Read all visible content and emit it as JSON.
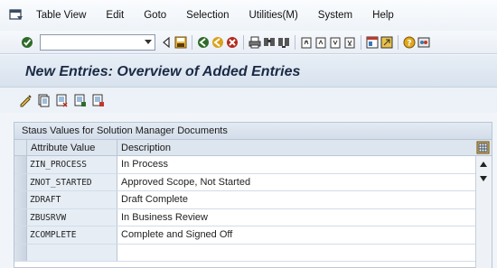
{
  "menu": {
    "items": [
      {
        "label": "Table View"
      },
      {
        "label": "Edit"
      },
      {
        "label": "Goto"
      },
      {
        "label": "Selection"
      },
      {
        "label": "Utilities(M)"
      },
      {
        "label": "System"
      },
      {
        "label": "Help"
      }
    ]
  },
  "toolbar": {
    "command_field_value": ""
  },
  "page": {
    "title": "New Entries: Overview of Added Entries"
  },
  "table": {
    "caption": "Staus Values for Solution Manager Documents",
    "columns": [
      "Attribute Value",
      "Description"
    ],
    "rows": [
      {
        "attribute": "ZIN_PROCESS",
        "description": "In Process"
      },
      {
        "attribute": "ZNOT_STARTED",
        "description": "Approved Scope, Not Started"
      },
      {
        "attribute": "ZDRAFT",
        "description": "Draft Complete"
      },
      {
        "attribute": "ZBUSRVW",
        "description": "In Business Review"
      },
      {
        "attribute": "ZCOMPLETE",
        "description": "Complete and Signed Off"
      },
      {
        "attribute": "",
        "description": ""
      }
    ]
  },
  "colors": {
    "accent": "#1b2a44",
    "header_bg": "#dde5ee",
    "key_column_bg": "#e6edf5"
  }
}
